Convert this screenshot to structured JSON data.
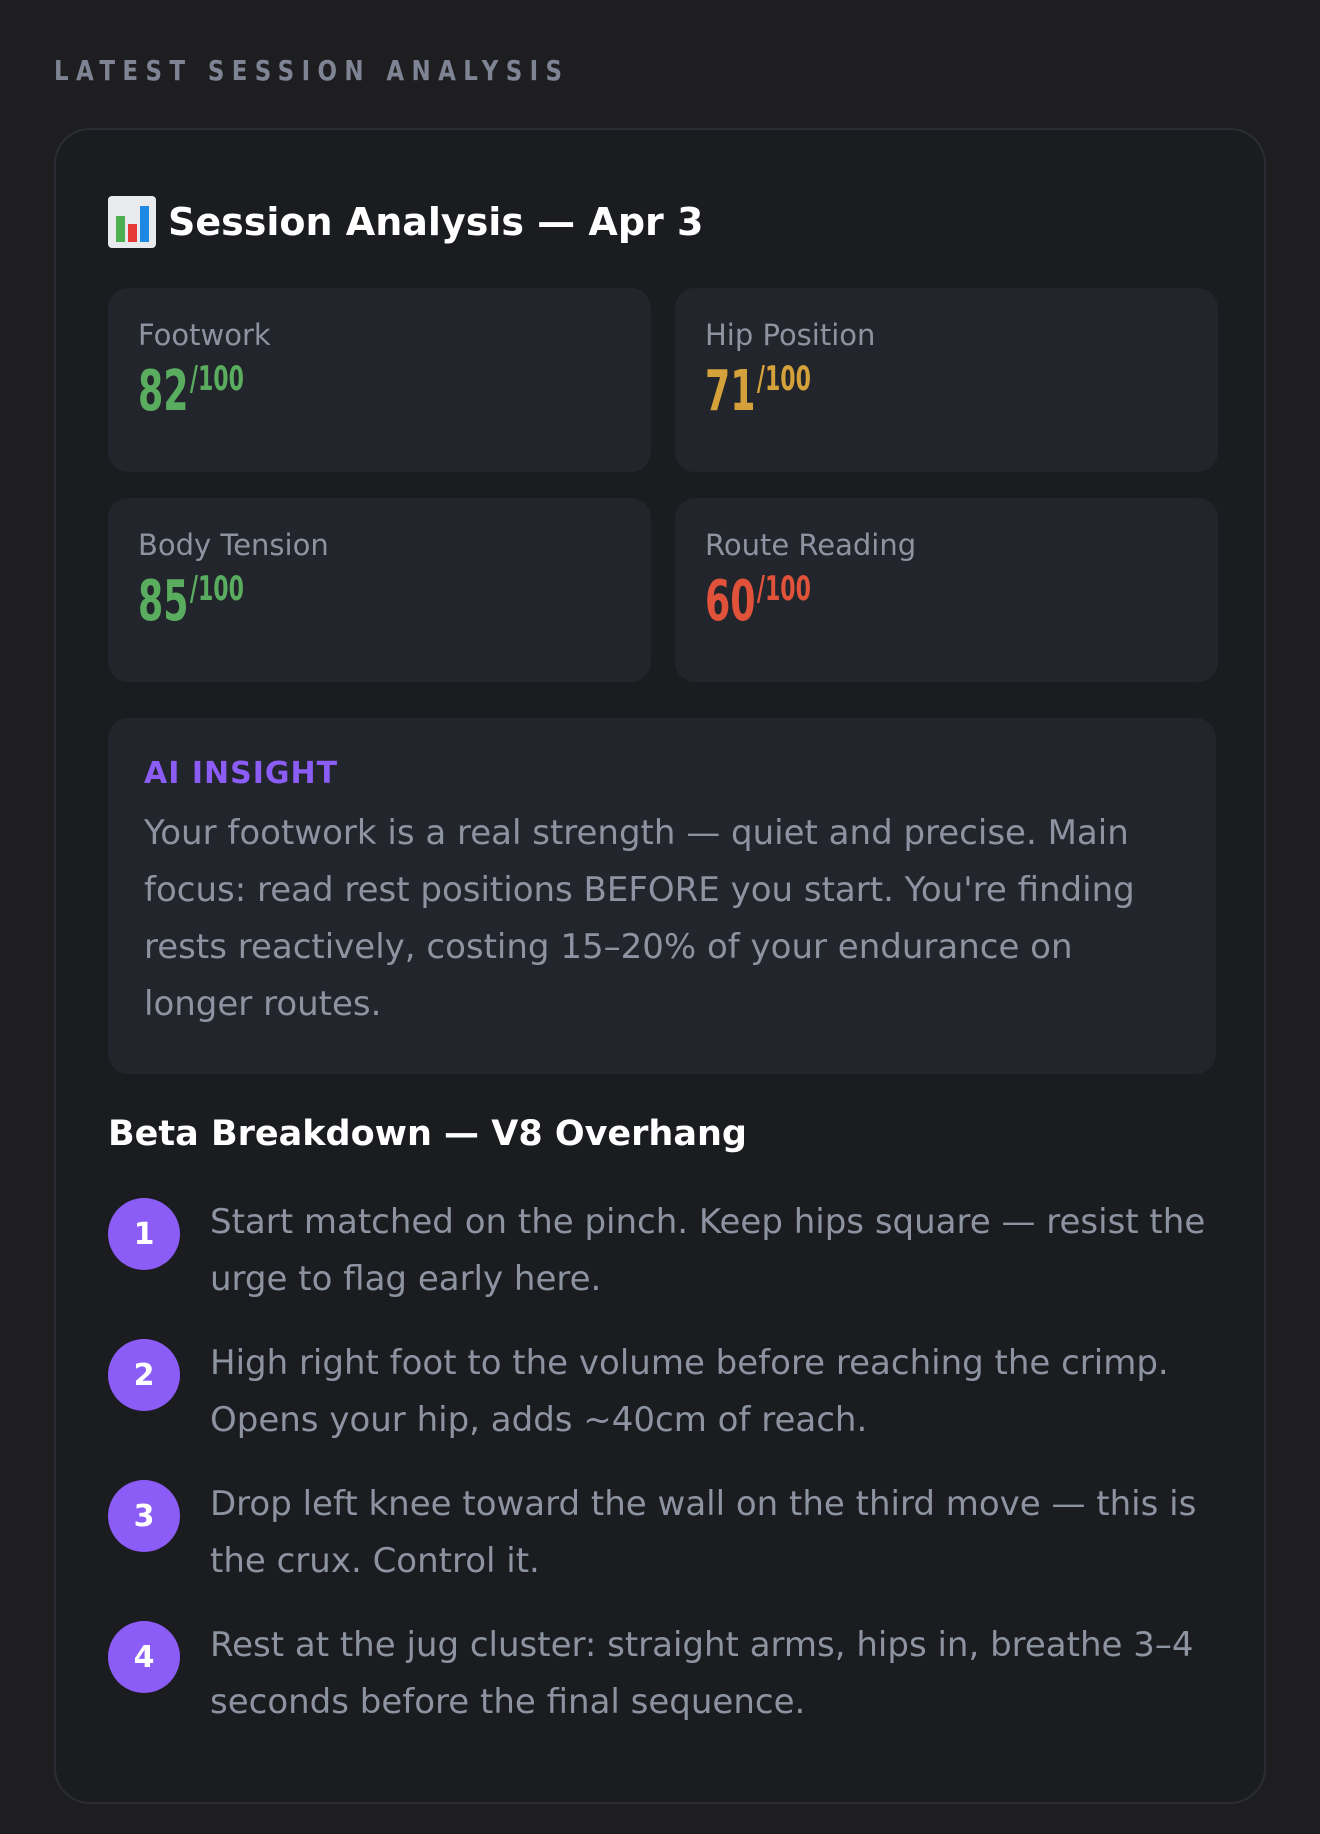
{
  "section_label": "LATEST SESSION ANALYSIS",
  "card": {
    "title_icon": "bar-chart-icon",
    "title": "Session Analysis — Apr 3"
  },
  "metrics": [
    {
      "label": "Footwork",
      "score": "82",
      "max": "/100",
      "color": "#5aac5f"
    },
    {
      "label": "Hip Position",
      "score": "71",
      "max": "/100",
      "color": "#d4a13a"
    },
    {
      "label": "Body Tension",
      "score": "85",
      "max": "/100",
      "color": "#5aac5f"
    },
    {
      "label": "Route Reading",
      "score": "60",
      "max": "/100",
      "color": "#e0533a"
    }
  ],
  "insight": {
    "title": "AI INSIGHT",
    "text": "Your footwork is a real strength — quiet and precise. Main focus: read rest positions BEFORE you start. You're finding rests reactively, costing 15–20% of your endurance on longer routes."
  },
  "beta": {
    "title": "Beta Breakdown — V8 Overhang",
    "steps": [
      {
        "num": "1",
        "text": "Start matched on the pinch. Keep hips square — resist the urge to flag early here."
      },
      {
        "num": "2",
        "text": "High right foot to the volume before reaching the crimp. Opens your hip, adds ~40cm of reach."
      },
      {
        "num": "3",
        "text": "Drop left knee toward the wall on the third move — this is the crux. Control it."
      },
      {
        "num": "4",
        "text": "Rest at the jug cluster: straight arms, hips in, breathe 3–4 seconds before the final sequence."
      }
    ]
  },
  "colors": {
    "accent": "#8b5cf6",
    "background": "#1e1e20",
    "card": "#1a1c20",
    "panel": "#22252b",
    "muted_text": "#8d93a1"
  }
}
